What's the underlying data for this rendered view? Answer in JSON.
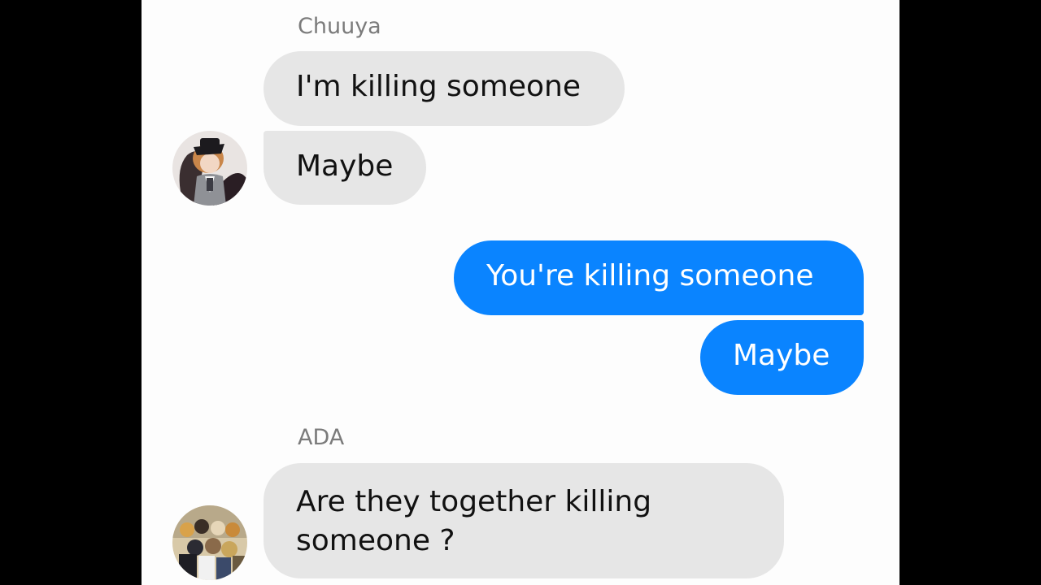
{
  "conversation": {
    "groups": [
      {
        "sender": "Chuuya",
        "avatar_icon": "chuuya-avatar-icon",
        "messages": [
          "I'm killing someone",
          "Maybe"
        ]
      },
      {
        "sender": "me",
        "messages": [
          "You're killing someone",
          "Maybe"
        ]
      },
      {
        "sender": "ADA",
        "avatar_icon": "ada-group-avatar-icon",
        "messages": [
          "Are they together killing someone ?"
        ]
      }
    ]
  },
  "colors": {
    "outgoing_bubble": "#0a84ff",
    "incoming_bubble": "#e6e6e6",
    "sender_name": "#7b7b7b",
    "background": "#fdfdfd",
    "letterbox": "#000000"
  }
}
